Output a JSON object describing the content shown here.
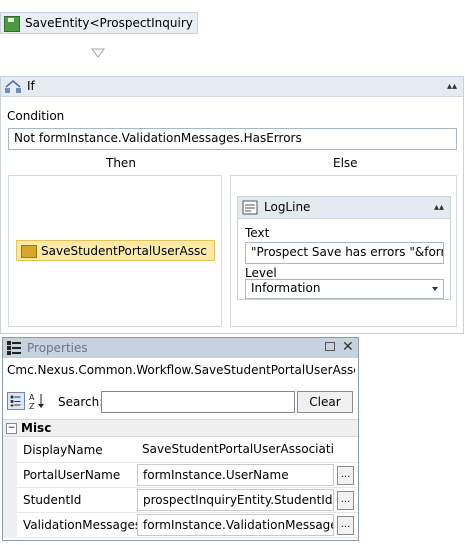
{
  "top_activity": {
    "label": "SaveEntity<ProspectInquiry"
  },
  "if_activity": {
    "title": "If",
    "condition_label": "Condition",
    "condition_value": "Not formInstance.ValidationMessages.HasErrors",
    "then_label": "Then",
    "else_label": "Else",
    "then_activity": {
      "label": "SaveStudentPortalUserAssc"
    },
    "else_activity": {
      "title": "LogLine",
      "text_label": "Text",
      "text_value": "\"Prospect  Save has errors \"&formIn",
      "level_label": "Level",
      "level_value": "Information"
    }
  },
  "properties": {
    "title": "Properties",
    "type_name": "Cmc.Nexus.Common.Workflow.SaveStudentPortalUserAssociatio...",
    "search_label": "Search:",
    "search_value": "",
    "clear_label": "Clear",
    "category": "Misc",
    "rows": [
      {
        "name": "DisplayName",
        "value": "SaveStudentPortalUserAssociation",
        "has_button": false
      },
      {
        "name": "PortalUserName",
        "value": "formInstance.UserName",
        "has_button": true
      },
      {
        "name": "StudentId",
        "value": "prospectInquiryEntity.StudentId",
        "has_button": true
      },
      {
        "name": "ValidationMessages",
        "value": "formInstance.ValidationMessages",
        "has_button": true
      }
    ],
    "ellipsis_label": "..."
  },
  "icons": [
    "save-icon",
    "if-icon",
    "logline-icon",
    "properties-icon",
    "categorized-icon",
    "alphabetical-icon",
    "pin-icon",
    "close-icon",
    "collapse-icon",
    "arrow-down-icon"
  ]
}
